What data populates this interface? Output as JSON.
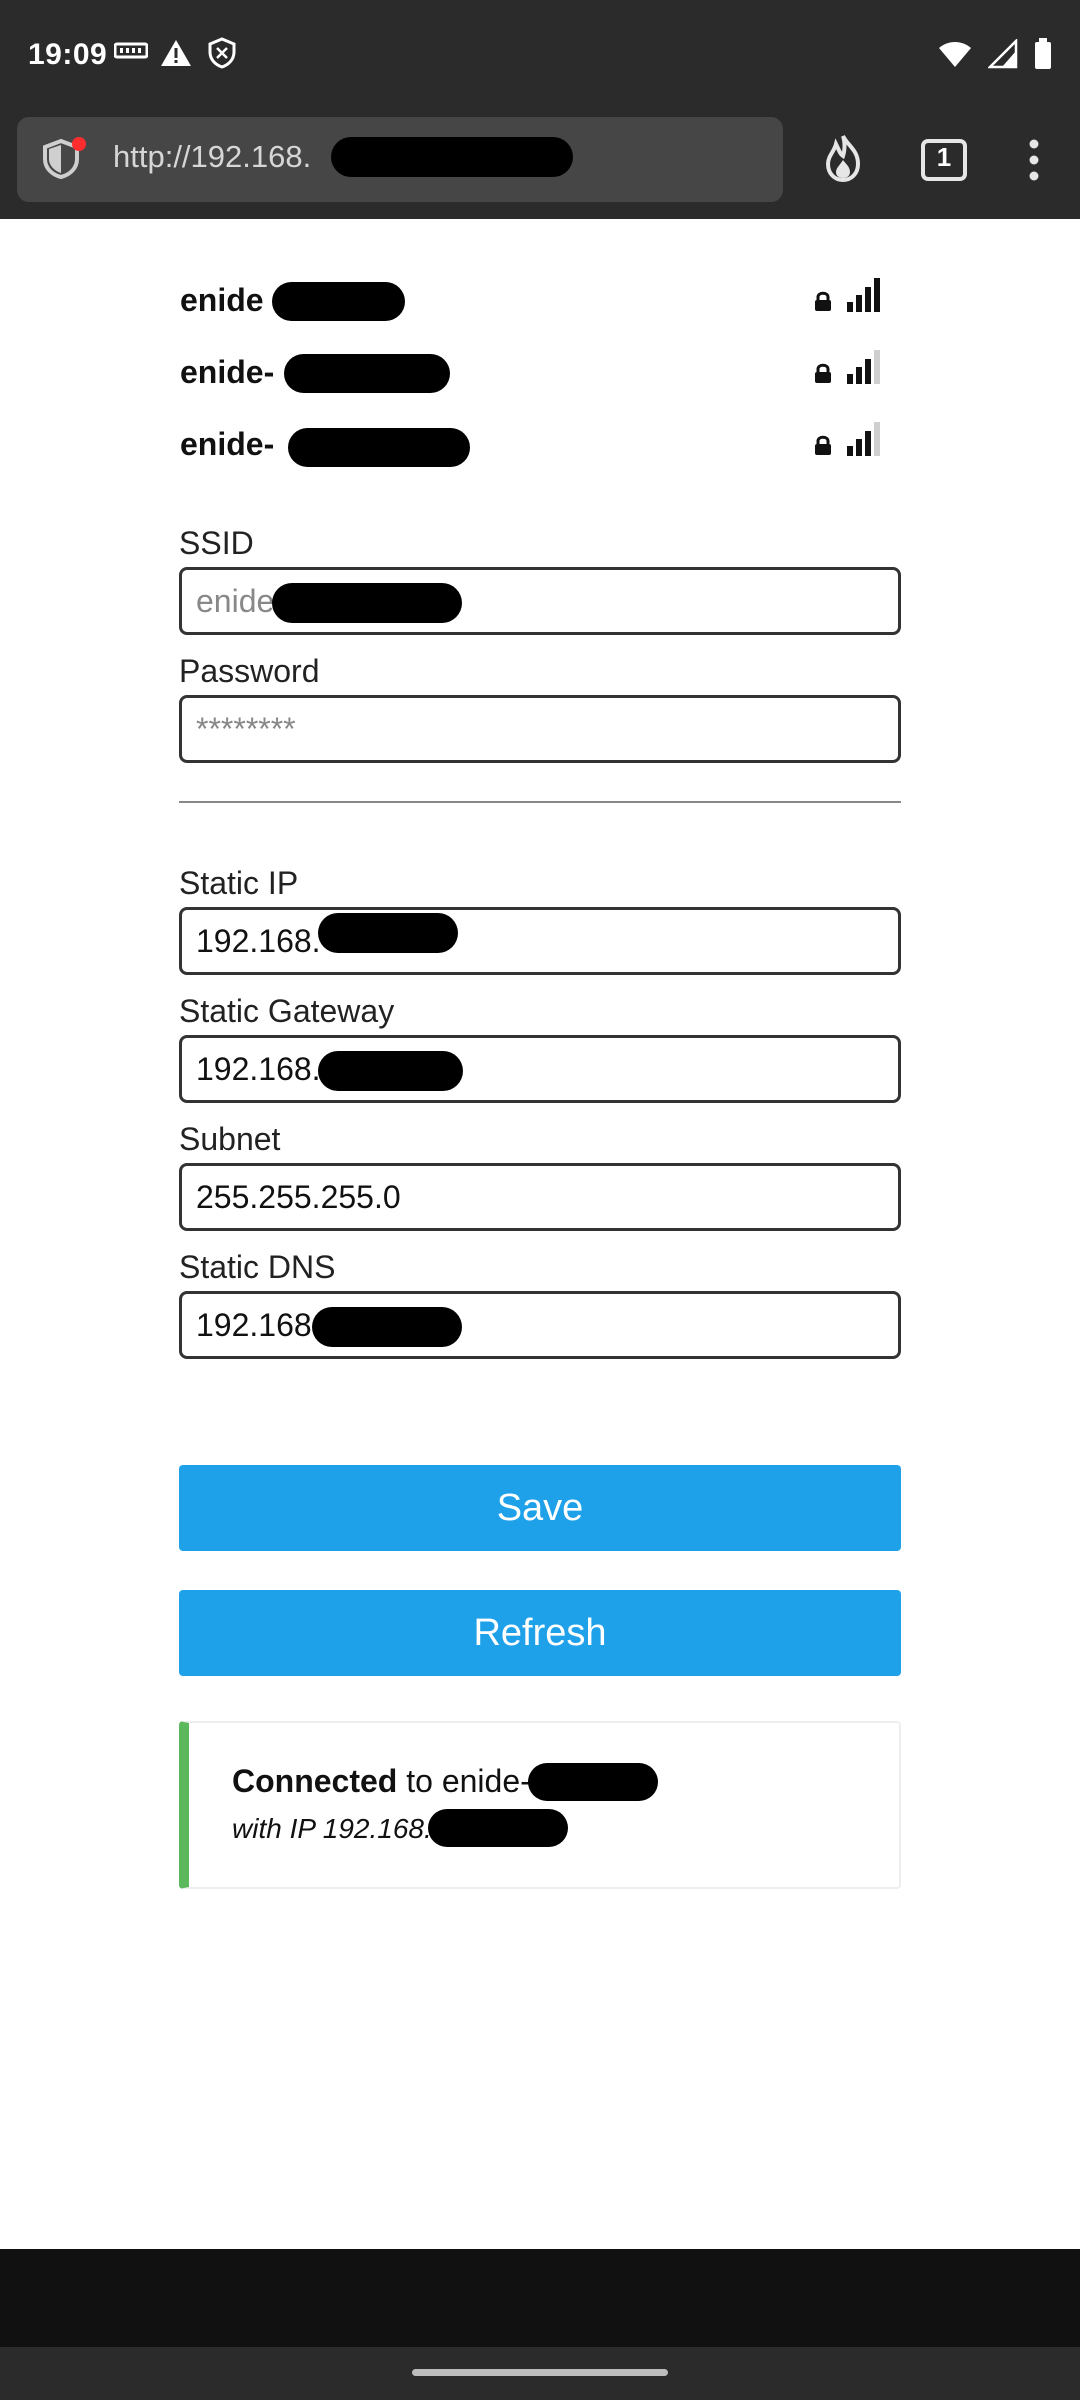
{
  "statusbar": {
    "time": "19:09",
    "icons_left": [
      "memory-icon",
      "warning-icon",
      "shield-icon"
    ],
    "icons_right": [
      "wifi-icon",
      "cell-signal-icon",
      "battery-icon"
    ]
  },
  "browser": {
    "url": "http://192.168.",
    "tab_count": "1",
    "icons": [
      "tracking-shield-icon",
      "fire-icon",
      "tabs-icon",
      "overflow-menu-icon"
    ]
  },
  "networks": [
    {
      "name": "enide",
      "signal": 4,
      "locked": true
    },
    {
      "name": "enide-",
      "signal": 3,
      "locked": true
    },
    {
      "name": "enide-",
      "signal": 3,
      "locked": true
    }
  ],
  "form": {
    "ssid_label": "SSID",
    "ssid_placeholder": "enide",
    "password_label": "Password",
    "password_value": "********",
    "static_ip_label": "Static IP",
    "static_ip_value": "192.168.",
    "gateway_label": "Static Gateway",
    "gateway_value": "192.168.",
    "subnet_label": "Subnet",
    "subnet_value": "255.255.255.0",
    "dns_label": "Static DNS",
    "dns_value": "192.168"
  },
  "buttons": {
    "save": "Save",
    "refresh": "Refresh"
  },
  "status": {
    "connected_bold": "Connected",
    "connected_rest": " to enide-",
    "ip_text": "with IP 192.168."
  },
  "colors": {
    "accent": "#1fa1ea",
    "success": "#5cb85c"
  }
}
